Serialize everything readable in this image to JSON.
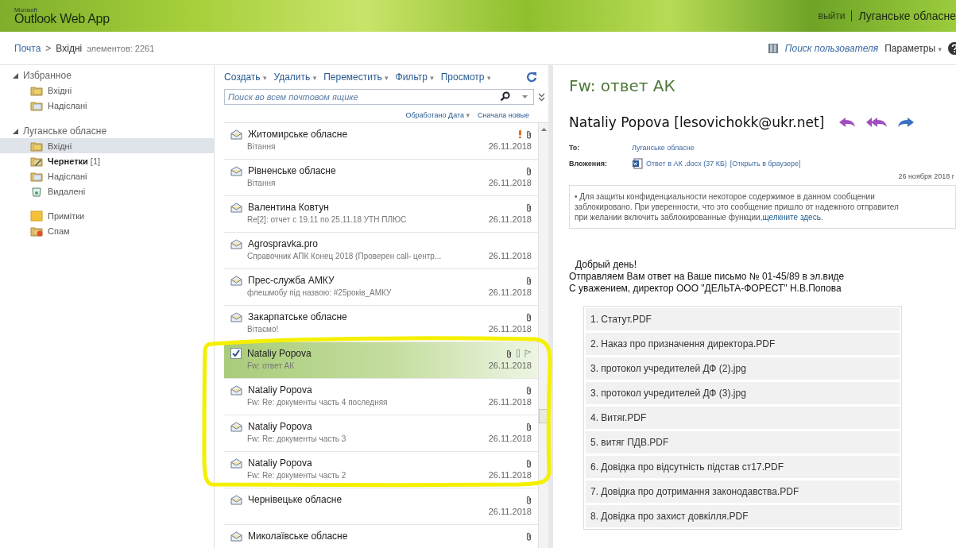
{
  "header": {
    "brand_small": "Microsoft",
    "brand": "Outlook Web App",
    "sign_out": "выйти",
    "account": "Луганське обласне"
  },
  "breadcrumb": {
    "root": "Почта",
    "separator": ">",
    "folder": "Вхідні",
    "count": "элементов: 2261"
  },
  "top_links": {
    "find_user": "Поиск пользователя",
    "options": "Параметры",
    "caret": "▾"
  },
  "sidebar": {
    "groups": [
      {
        "title": "Избранное",
        "expanded": true,
        "items": [
          {
            "label": "Вхідні",
            "kind": "inbox",
            "selected": false
          },
          {
            "label": "Надіслані",
            "kind": "sent",
            "selected": false
          }
        ]
      },
      {
        "title": "Луганське обласне",
        "expanded": true,
        "items": [
          {
            "label": "Вхідні",
            "kind": "inbox",
            "selected": true
          },
          {
            "label": "Чернетки",
            "count": "[1]",
            "kind": "drafts",
            "selected": false
          },
          {
            "label": "Надіслані",
            "kind": "sent",
            "selected": false
          },
          {
            "label": "Видалені",
            "kind": "deleted",
            "selected": false
          },
          {
            "label": "Примітки",
            "kind": "notes",
            "selected": false
          },
          {
            "label": "Спам",
            "kind": "junk",
            "selected": false
          }
        ]
      }
    ]
  },
  "toolbar": [
    {
      "label": "Создать",
      "caret": "▾"
    },
    {
      "label": "Удалить",
      "caret": "▾"
    },
    {
      "label": "Переместить",
      "caret": "▾"
    },
    {
      "label": "Фильтр",
      "caret": "▾"
    },
    {
      "label": "Просмотр",
      "caret": "▾"
    }
  ],
  "search": {
    "placeholder": "Поиск во всем почтовом ящике"
  },
  "sort": {
    "by": "Обработано Дата",
    "caret": "▾",
    "order": "Сначала новые"
  },
  "messages": [
    {
      "sender": "Житомирське обласне",
      "preview": "Вітання",
      "date": "26.11.2018",
      "attachment": true,
      "important": true,
      "selected": false
    },
    {
      "sender": "Рівненське обласне",
      "preview": "Вітання",
      "date": "26.11.2018",
      "attachment": true,
      "important": false,
      "selected": false
    },
    {
      "sender": "Валентина Ковтун",
      "preview": "Re[2]: отчет с 19.11 по 25.11.18 УТН ПЛЮС",
      "date": "26.11.2018",
      "attachment": true,
      "important": false,
      "selected": false
    },
    {
      "sender": "Agrospravka.pro",
      "preview": "Справочник АПК Конец 2018 (Проверен call- центр...",
      "date": "26.11.2018",
      "attachment": false,
      "important": false,
      "selected": false
    },
    {
      "sender": "Прес-служба АМКУ",
      "preview": "флешмобу під назвою: #25років_АМКУ",
      "date": "26.11.2018",
      "attachment": true,
      "important": false,
      "selected": false
    },
    {
      "sender": "Закарпатське обласне",
      "preview": "Вітаємо!",
      "date": "26.11.2018",
      "attachment": true,
      "important": false,
      "selected": false
    },
    {
      "sender": "Nataliy Popova",
      "preview": "Fw: ответ АК",
      "date": "26.11.2018",
      "attachment": true,
      "important": false,
      "selected": true
    },
    {
      "sender": "Nataliy Popova",
      "preview": "Fw: Re: документы часть 4 последняя",
      "date": "26.11.2018",
      "attachment": true,
      "important": false,
      "selected": false
    },
    {
      "sender": "Nataliy Popova",
      "preview": "Fw: Re: документы часть 3",
      "date": "26.11.2018",
      "attachment": true,
      "important": false,
      "selected": false
    },
    {
      "sender": "Nataliy Popova",
      "preview": "Fw: Re: документы часть 2",
      "date": "26.11.2018",
      "attachment": true,
      "important": false,
      "selected": false
    },
    {
      "sender": "Чернівецьке обласне",
      "date": "26.11.2018",
      "attachment": true,
      "important": false,
      "selected": false
    },
    {
      "sender": "Миколаївське обласне",
      "attachment": true,
      "important": false,
      "selected": false
    }
  ],
  "reading_pane": {
    "subject": "Fw: ответ АК",
    "from": "Nataliy Popova [lesovichokk@ukr.net]",
    "to_label": "To:",
    "to": "Луганське обласне",
    "attachments_label": "Вложения:",
    "attachment": "Ответ в АК .docx (37 КБ)",
    "open_in_browser": "[Открыть в браузере]",
    "date": "26 ноября 2018 г",
    "notice_lines": [
      "• Для защиты конфиденциальности некоторое содержимое в данном сообщении",
      "заблокировано. При уверенности, что это сообщение пришло от надежного отправител",
      "при желании включить заблокированные функции,"
    ],
    "notice_link": "щелкните здесь.",
    "body": [
      "Добрый день!",
      "Отправляем Вам  ответ на Ваше письмо № 01-45/89  в эл.виде",
      "С уважением, директор ООО \"ДЕЛЬТА-ФОРЕСТ\"  Н.В.Попова"
    ],
    "files": [
      "1. Статут.PDF",
      "2. Наказ про призначення директора.PDF",
      "3. протокол учредителей ДФ (2).jpg",
      "3. протокол учредителей ДФ (3).jpg",
      "4. Витяг.PDF",
      "5. витяг ПДВ.PDF",
      "6. Довідка про відсутність підстав ст17.PDF",
      "7. Довідка про дотримання законодавства.PDF",
      "8. Довідка про захист довкілля.PDF"
    ]
  }
}
